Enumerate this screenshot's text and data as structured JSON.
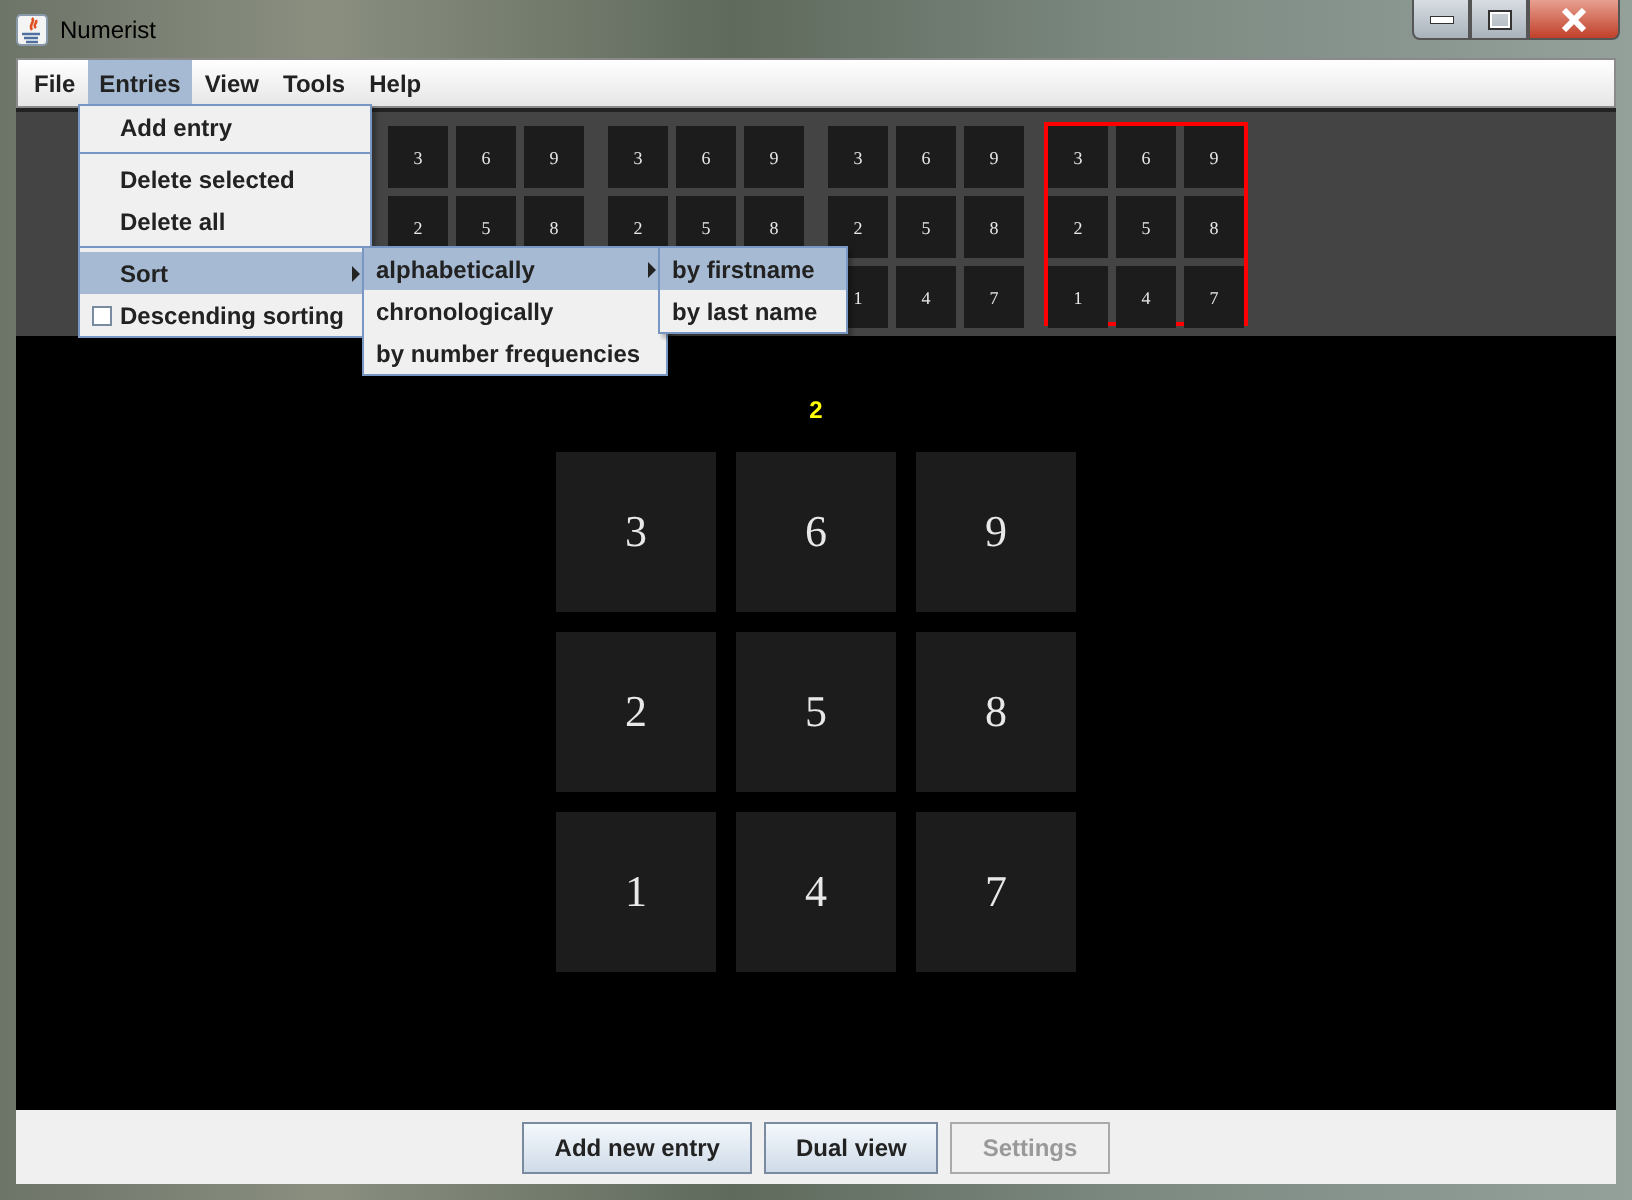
{
  "window": {
    "title": "Numerist"
  },
  "menu_bar": [
    {
      "label": "File",
      "selected": false
    },
    {
      "label": "Entries",
      "selected": true
    },
    {
      "label": "View",
      "selected": false
    },
    {
      "label": "Tools",
      "selected": false
    },
    {
      "label": "Help",
      "selected": false
    }
  ],
  "entries_menu": [
    {
      "kind": "item",
      "label": "Add entry",
      "selected": false
    },
    {
      "kind": "separator"
    },
    {
      "kind": "item",
      "label": "Delete selected",
      "selected": false
    },
    {
      "kind": "item",
      "label": "Delete all",
      "selected": false
    },
    {
      "kind": "separator"
    },
    {
      "kind": "submenu",
      "label": "Sort",
      "selected": true
    },
    {
      "kind": "checkbox",
      "label": "Descending sorting",
      "checked": false,
      "selected": false
    }
  ],
  "sort_menu": [
    {
      "kind": "submenu",
      "label": "alphabetically",
      "selected": true
    },
    {
      "kind": "item",
      "label": "chronologically",
      "selected": false
    },
    {
      "kind": "item",
      "label": "by number frequencies",
      "selected": false
    }
  ],
  "alphabetically_menu": [
    {
      "kind": "item",
      "label": "by firstname",
      "selected": true
    },
    {
      "kind": "item",
      "label": "by last name",
      "selected": false
    }
  ],
  "thumbnails": [
    {
      "selected": false,
      "rows": [
        [
          "3",
          "6",
          "9"
        ],
        [
          "2",
          "5",
          "8"
        ]
      ]
    },
    {
      "selected": false,
      "rows": [
        [
          "3",
          "6",
          "9"
        ],
        [
          "2",
          "5",
          "8"
        ]
      ]
    },
    {
      "selected": false,
      "rows": [
        [
          "3",
          "6",
          "9"
        ],
        [
          "2",
          "5",
          "8"
        ],
        [
          "1",
          "4",
          "7"
        ]
      ]
    },
    {
      "selected": true,
      "rows": [
        [
          "3",
          "6",
          "9"
        ],
        [
          "2",
          "5",
          "8"
        ],
        [
          "1",
          "4",
          "7"
        ]
      ]
    }
  ],
  "current_label": "2",
  "grid": [
    [
      "3",
      "6",
      "9"
    ],
    [
      "2",
      "5",
      "8"
    ],
    [
      "1",
      "4",
      "7"
    ]
  ],
  "buttons": [
    {
      "label": "Add new entry",
      "disabled": false
    },
    {
      "label": "Dual view",
      "disabled": false
    },
    {
      "label": "Settings",
      "disabled": true
    }
  ]
}
